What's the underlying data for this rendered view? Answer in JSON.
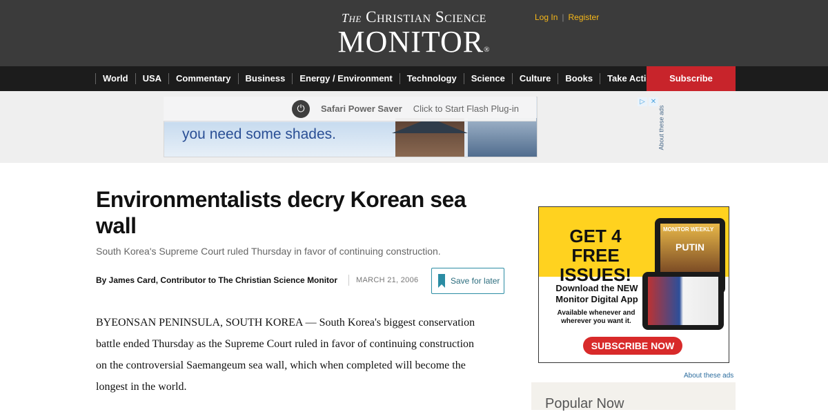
{
  "header": {
    "logo_the": "The",
    "logo_top": "Christian Science",
    "logo_main": "MONITOR",
    "logo_reg": "®",
    "login_label": "Log In",
    "separator": "|",
    "register_label": "Register"
  },
  "nav": {
    "items": [
      "World",
      "USA",
      "Commentary",
      "Business",
      "Energy / Environment",
      "Technology",
      "Science",
      "Culture",
      "Books",
      "Take Action"
    ],
    "search_icon": "search-icon",
    "subscribe_label": "Subscribe"
  },
  "top_ad": {
    "banner_text": "you need some shades.",
    "flash_title": "Safari Power Saver",
    "flash_message": "Click to Start Flash Plug-in",
    "about_ads_vertical": "About these ads"
  },
  "article": {
    "headline": "Environmentalists decry Korean sea wall",
    "subhead": "South Korea's Supreme Court ruled Thursday in favor of continuing construction.",
    "byline": "By James Card, Contributor to The Christian Science Monitor",
    "date": "MARCH 21, 2006",
    "save_label": "Save for later",
    "body": "BYEONSAN PENINSULA, SOUTH KOREA — South Korea's biggest conservation battle ended Thursday as the Supreme Court ruled in favor of continuing construction on the controversial Saemangeum sea wall, which when completed will become the longest in the world."
  },
  "side_ad": {
    "headline": "GET 4 FREE ISSUES!",
    "magazine_brand": "MONITOR WEEKLY",
    "magazine_cover": "PUTIN",
    "line1": "Download the NEW Monitor Digital App",
    "line2": "Available whenever and wherever you want it.",
    "button": "SUBSCRIBE NOW",
    "about_ads": "About these ads"
  },
  "popular": {
    "title": "Popular Now"
  },
  "colors": {
    "masthead": "#3b3b3b",
    "nav": "#1c1c1c",
    "subscribe": "#c8242b",
    "accent_link": "#f7b819",
    "save_teal": "#2b8ca3"
  }
}
